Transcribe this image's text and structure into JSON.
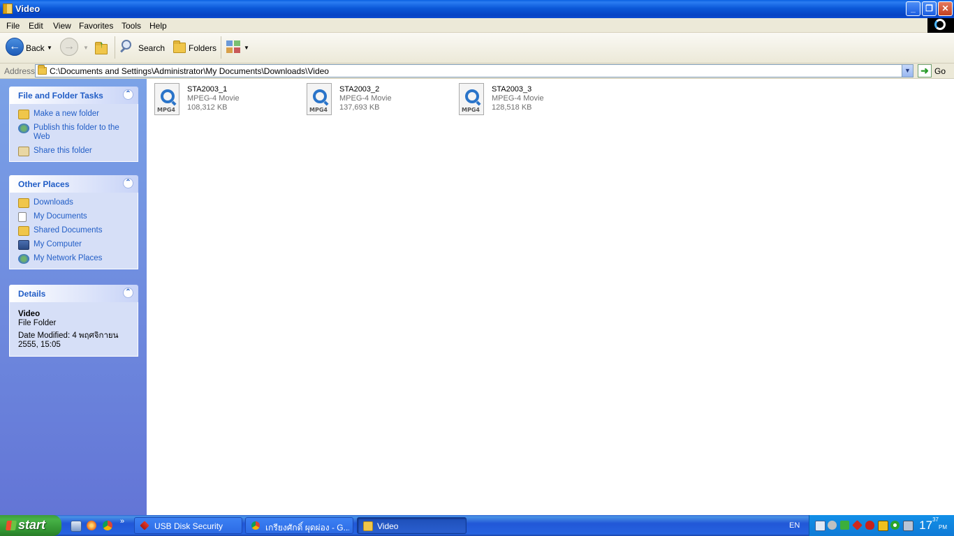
{
  "window": {
    "title": "Video"
  },
  "menu": [
    "File",
    "Edit",
    "View",
    "Favorites",
    "Tools",
    "Help"
  ],
  "toolbar": {
    "back": "Back",
    "search": "Search",
    "folders": "Folders"
  },
  "address": {
    "label": "Address",
    "path": "C:\\Documents and Settings\\Administrator\\My Documents\\Downloads\\Video",
    "go": "Go"
  },
  "tasks_panel": {
    "title": "File and Folder Tasks",
    "items": [
      "Make a new folder",
      "Publish this folder to the Web",
      "Share this folder"
    ]
  },
  "places_panel": {
    "title": "Other Places",
    "items": [
      "Downloads",
      "My Documents",
      "Shared Documents",
      "My Computer",
      "My Network Places"
    ]
  },
  "details_panel": {
    "title": "Details",
    "name": "Video",
    "type": "File Folder",
    "modified": "Date Modified: 4 พฤศจิกายน 2555, 15:05"
  },
  "files": [
    {
      "name": "STA2003_1",
      "type": "MPEG-4 Movie",
      "size": "108,312 KB",
      "badge": "MPG4"
    },
    {
      "name": "STA2003_2",
      "type": "MPEG-4 Movie",
      "size": "137,693 KB",
      "badge": "MPG4"
    },
    {
      "name": "STA2003_3",
      "type": "MPEG-4 Movie",
      "size": "128,518 KB",
      "badge": "MPG4"
    }
  ],
  "taskbar": {
    "start": "start",
    "tasks": [
      "USB Disk Security",
      "เกรียงศักดิ์ ผุดผ่อง - G...",
      "Video"
    ],
    "language": "EN",
    "clock": {
      "time": "17",
      "minutes": "37",
      "ampm": "PM"
    }
  },
  "icons": {
    "back": "back-arrow-icon",
    "forward": "forward-arrow-icon",
    "up": "up-folder-icon",
    "search": "magnifier-icon",
    "folders": "folder-icon",
    "views": "views-icon"
  },
  "colors": {
    "titlebar": "#0b58d8",
    "panel_link": "#215dc6",
    "start": "#3c9a3c"
  }
}
